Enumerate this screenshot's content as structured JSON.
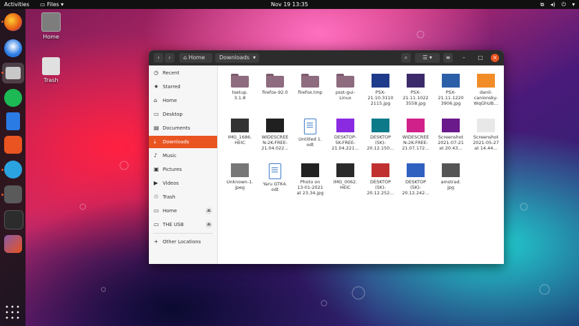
{
  "topbar": {
    "activities": "Activities",
    "app_menu": "Files",
    "clock": "Nov 19  13:35"
  },
  "desktop_icons": [
    {
      "label": "Home",
      "icon": "home-folder-icon"
    },
    {
      "label": "Trash",
      "icon": "trash-icon"
    }
  ],
  "dock_apps": [
    "firefox-icon",
    "thunderbird-icon",
    "files-icon",
    "spotify-icon",
    "libreoffice-writer-icon",
    "software-center-icon",
    "telegram-icon",
    "extensions-icon",
    "terminal-icon",
    "settings-icon",
    "app-grid-icon"
  ],
  "window": {
    "breadcrumb": [
      "Home",
      "Downloads"
    ],
    "sidebar": [
      {
        "label": "Recent",
        "icon": "clock-icon"
      },
      {
        "label": "Starred",
        "icon": "star-icon"
      },
      {
        "label": "Home",
        "icon": "home-icon"
      },
      {
        "label": "Desktop",
        "icon": "desktop-icon"
      },
      {
        "label": "Documents",
        "icon": "documents-icon"
      },
      {
        "label": "Downloads",
        "icon": "download-icon",
        "active": true
      },
      {
        "label": "Music",
        "icon": "music-icon"
      },
      {
        "label": "Pictures",
        "icon": "pictures-icon"
      },
      {
        "label": "Videos",
        "icon": "videos-icon"
      },
      {
        "label": "Trash",
        "icon": "trash-icon"
      },
      {
        "label": "Home",
        "icon": "drive-icon",
        "eject": true
      },
      {
        "label": "THE USB",
        "icon": "drive-icon",
        "eject": true
      },
      {
        "label": "Other Locations",
        "icon": "plus-icon"
      }
    ],
    "files": [
      {
        "name": "tsetup.\n3.1.8",
        "kind": "folder"
      },
      {
        "name": "firefox-92.0",
        "kind": "folder"
      },
      {
        "name": "firefox.tmp",
        "kind": "folder"
      },
      {
        "name": "psst-gui-\nLinux",
        "kind": "folder"
      },
      {
        "name": "PSX-\n21.10.3110\n2115.jpg",
        "kind": "image",
        "color": "#1e3a8a"
      },
      {
        "name": "PSX-\n21.11.1022\n3558.jpg",
        "kind": "image",
        "color": "#3b2a6a"
      },
      {
        "name": "PSX-\n21.11.1220\n3906.jpg",
        "kind": "image",
        "color": "#2b5fa8"
      },
      {
        "name": "danil-\ncanionsky-\nWqGhUB…",
        "kind": "image",
        "color": "#f28c28"
      },
      {
        "name": "IMG_1686.\nHEIC",
        "kind": "image",
        "color": "#333333"
      },
      {
        "name": "WIDESCREE\nN-2K-FREE-\n21.04.022…",
        "kind": "image",
        "color": "#202020"
      },
      {
        "name": "Untitled 1.\nodt",
        "kind": "doc"
      },
      {
        "name": "DESKTOP-\n5K-FREE-\n21.04.221…",
        "kind": "image",
        "color": "#8a2be2"
      },
      {
        "name": "DESKTOP\n(5K)-\n20.12.150…",
        "kind": "image",
        "color": "#0d7a8a"
      },
      {
        "name": "WIDESCREE\nN-2K-FREE-\n21.07.172…",
        "kind": "image",
        "color": "#d0208a"
      },
      {
        "name": "Screenshot\n2021-07-21\nat 20.43…",
        "kind": "image",
        "color": "#6a1a8a"
      },
      {
        "name": "Screenshot\n2021-05-27\nat 14.44…",
        "kind": "image",
        "color": "#e8e8e8"
      },
      {
        "name": "Unknown-1.\njpeg",
        "kind": "image",
        "color": "#777777"
      },
      {
        "name": "Yaru GTK4.\nodt",
        "kind": "doc"
      },
      {
        "name": "Photo on\n13-01-2021\nat 23.34.jpg",
        "kind": "image",
        "color": "#222222"
      },
      {
        "name": "IMG_0062.\nHEIC",
        "kind": "image",
        "color": "#2a2a2a"
      },
      {
        "name": "DESKTOP\n(5K)-\n20.12.252…",
        "kind": "image",
        "color": "#c03030"
      },
      {
        "name": "DESKTOP\n(5K)-\n20.12.242…",
        "kind": "image",
        "color": "#3060c0"
      },
      {
        "name": "amstrad.\njpg",
        "kind": "image",
        "color": "#555555"
      }
    ]
  },
  "colors": {
    "accent": "#e95420",
    "topbar": "#101010"
  }
}
